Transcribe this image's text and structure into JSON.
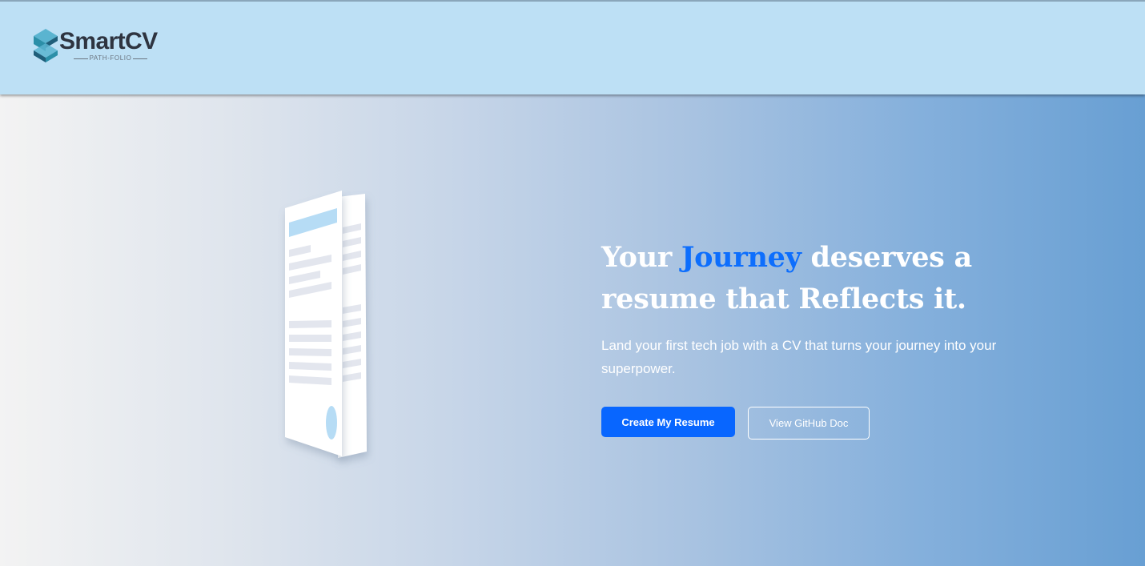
{
  "brand": {
    "name": "SmartCV",
    "tagline": "PATH-FOLIO",
    "logo_colors": [
      "#2b8fa8",
      "#5ab4d0",
      "#1f5e7a"
    ]
  },
  "hero": {
    "headline_before": "Your ",
    "headline_accent": "Journey",
    "headline_after": " deserves a resume that Reflects it.",
    "subtext": "Land your first tech job with a CV that turns your journey into your superpower.",
    "primary_button": "Create My Resume",
    "secondary_button": "View GitHub Doc"
  },
  "colors": {
    "header_bg": "#bde0f5",
    "accent": "#0d6efd",
    "primary_button_bg": "#0866ff",
    "gradient_start": "#f3f3f3",
    "gradient_end": "#689fd3"
  },
  "illustration": {
    "icon": "resume-documents-illustration"
  }
}
